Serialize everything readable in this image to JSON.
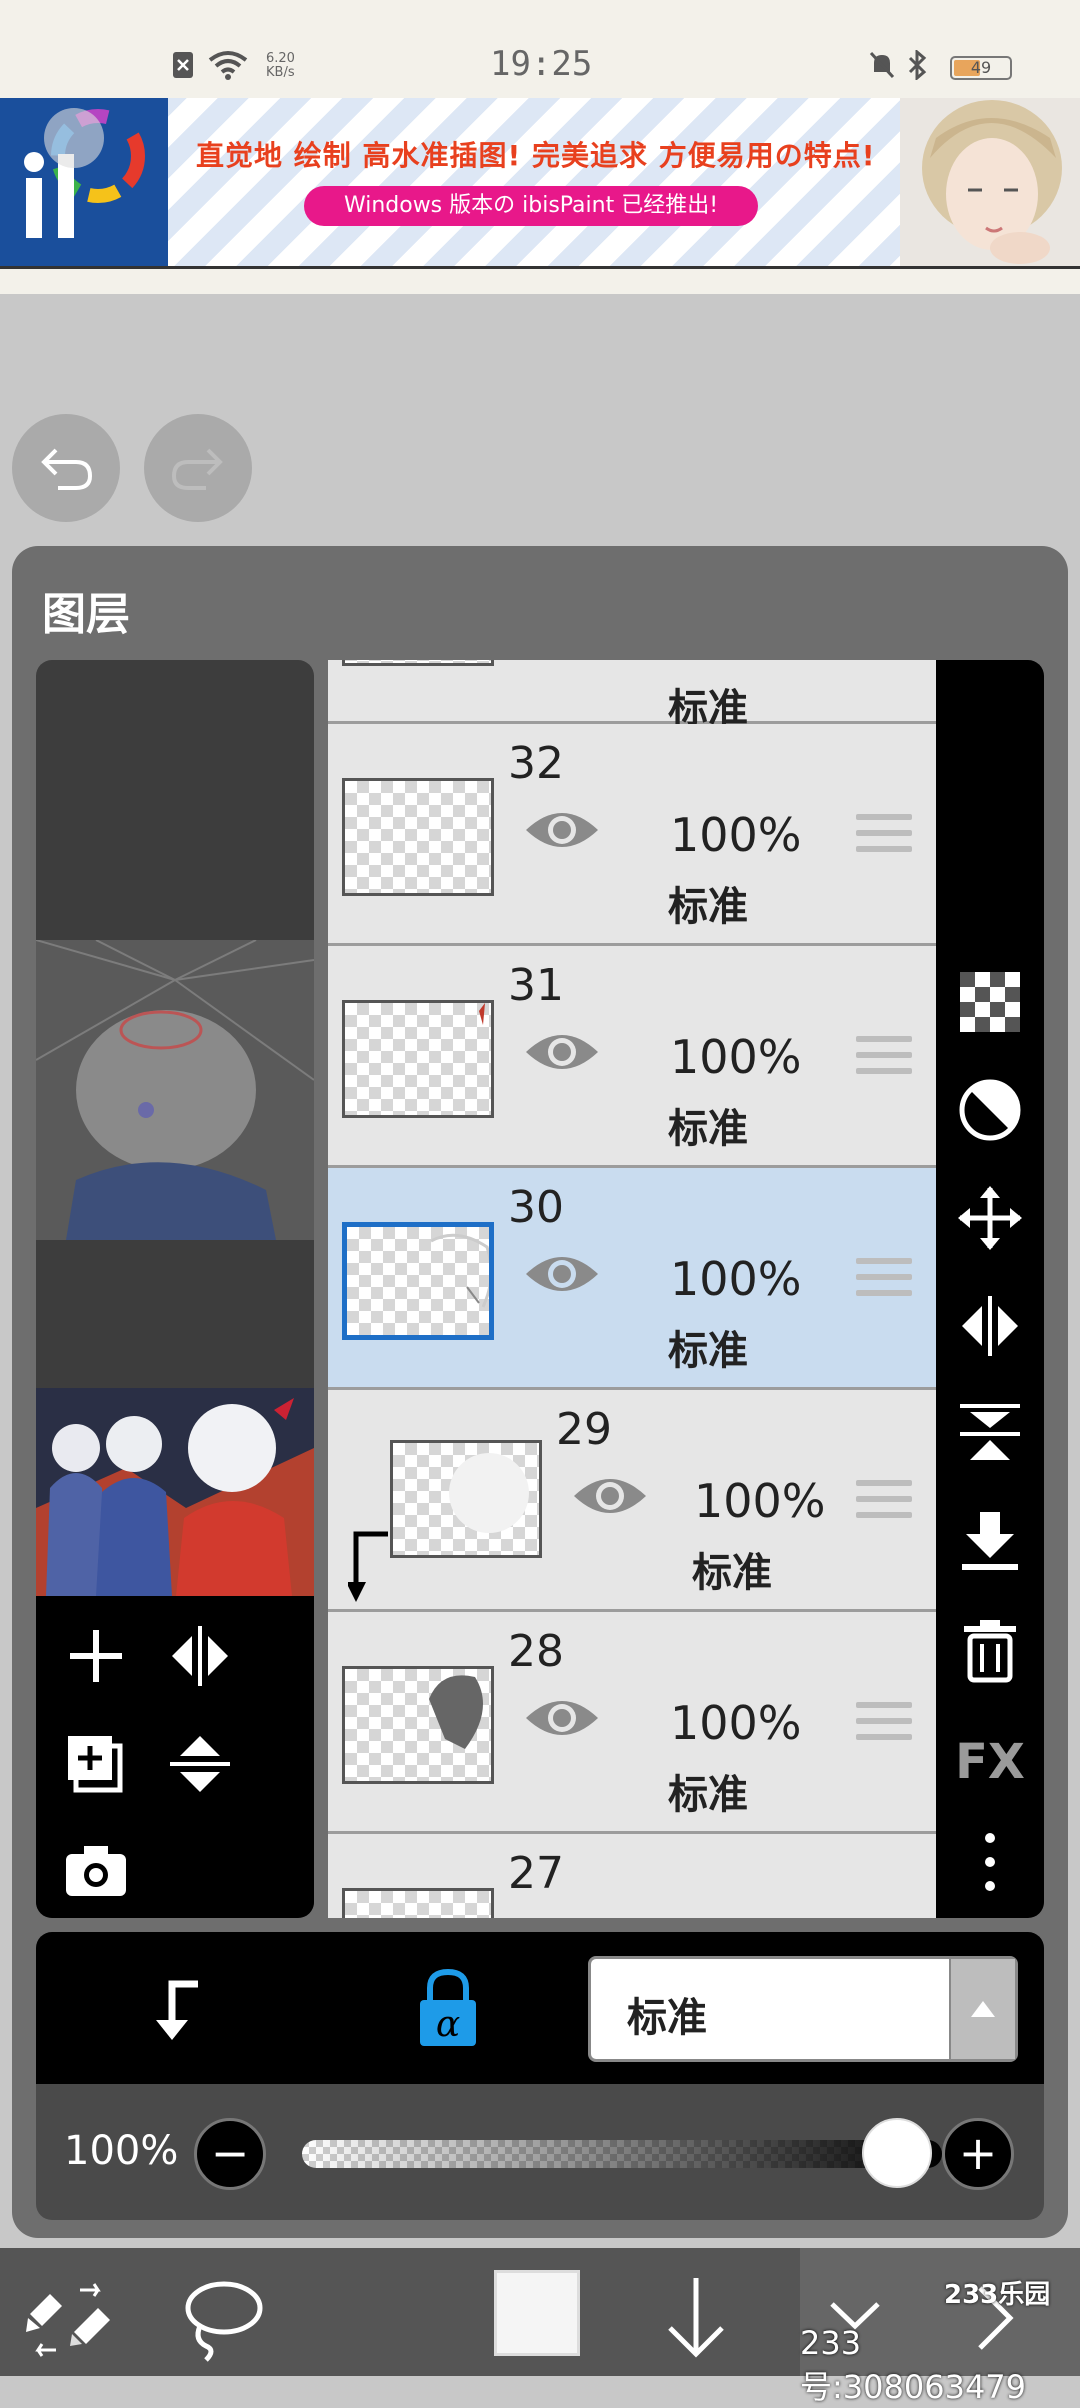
{
  "status_bar": {
    "time": "19:25",
    "net_speed_value": "6.20",
    "net_speed_unit": "KB/s",
    "battery": "49",
    "battery_level": 0.49
  },
  "ad": {
    "headline": "直觉地 绘制 高水准插图! 完美追求 方便易用の特点!",
    "sub": "Windows 版本の ibisPaint 已经推出!"
  },
  "panel": {
    "title": "图层"
  },
  "layers": [
    {
      "num": "32",
      "opacity": "100%",
      "mode": "标准",
      "selected": false
    },
    {
      "num": "31",
      "opacity": "100%",
      "mode": "标准",
      "selected": false
    },
    {
      "num": "30",
      "opacity": "100%",
      "mode": "标准",
      "selected": true
    },
    {
      "num": "29",
      "opacity": "100%",
      "mode": "标准",
      "selected": false,
      "clipped": true
    },
    {
      "num": "28",
      "opacity": "100%",
      "mode": "标准",
      "selected": false
    },
    {
      "num": "27",
      "opacity": "",
      "mode": "",
      "selected": false
    }
  ],
  "top_partial_layer_mode": "标准",
  "right_tools": [
    "checker-icon",
    "half-circle-icon",
    "move-icon",
    "flip-horizontal-icon",
    "flip-vertical-icon",
    "merge-down-icon",
    "trash-icon",
    "fx-label",
    "more-icon"
  ],
  "right_tools_fx": "FX",
  "blend": {
    "mode": "标准"
  },
  "opacity": {
    "label": "100%",
    "minus": "−",
    "plus": "+",
    "value": 1.0
  },
  "watermark": {
    "logo": "233乐园",
    "text": "233号:308063479"
  },
  "colors": {
    "selected_row": "#c9dcef",
    "accent": "#1e9be8",
    "selection_border": "#1e6fc7"
  }
}
